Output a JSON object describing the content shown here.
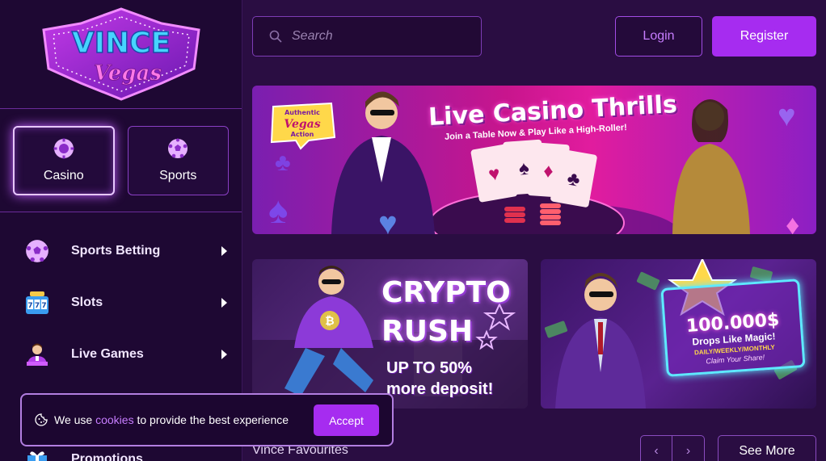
{
  "brand": {
    "name_top": "VINCE",
    "name_bottom": "Vegas"
  },
  "header": {
    "search_placeholder": "Search",
    "login_label": "Login",
    "register_label": "Register"
  },
  "modes": [
    {
      "label": "Casino",
      "icon": "chip-icon",
      "active": true
    },
    {
      "label": "Sports",
      "icon": "soccer-ball-icon",
      "active": false
    }
  ],
  "sidebar": {
    "items": [
      {
        "label": "Sports Betting",
        "icon": "soccer-ball-icon"
      },
      {
        "label": "Slots",
        "icon": "slot-machine-icon"
      },
      {
        "label": "Live Games",
        "icon": "dealer-icon"
      },
      {
        "label": "Promotions",
        "icon": "gift-icon"
      }
    ]
  },
  "banners": {
    "hero": {
      "badge_top": "Authentic",
      "badge_mid": "Vegas",
      "badge_bottom": "Action",
      "title": "Live Casino Thrills",
      "subtitle": "Join a Table Now & Play Like a High-Roller!"
    },
    "crypto": {
      "title_line1": "CRYPTO",
      "title_line2": "RUSH",
      "sub_line1": "UP TO 50%",
      "sub_line2": "more deposit!"
    },
    "drops": {
      "amount": "100.000$",
      "subtitle": "Drops Like Magic!",
      "frequency": "DAILY/WEEKLY/MONTHLY",
      "claim": "Claim Your Share!"
    }
  },
  "favourites": {
    "title": "Vince Favourites",
    "see_more": "See More",
    "prev": "‹",
    "next": "›"
  },
  "cookie": {
    "text_before": "We use ",
    "link": "cookies",
    "text_after": " to provide the best experience",
    "accept": "Accept"
  },
  "colors": {
    "accent": "#a62cf0",
    "bg": "#2a0d42",
    "sidebar_bg": "#1e0833",
    "link": "#c77dff"
  }
}
